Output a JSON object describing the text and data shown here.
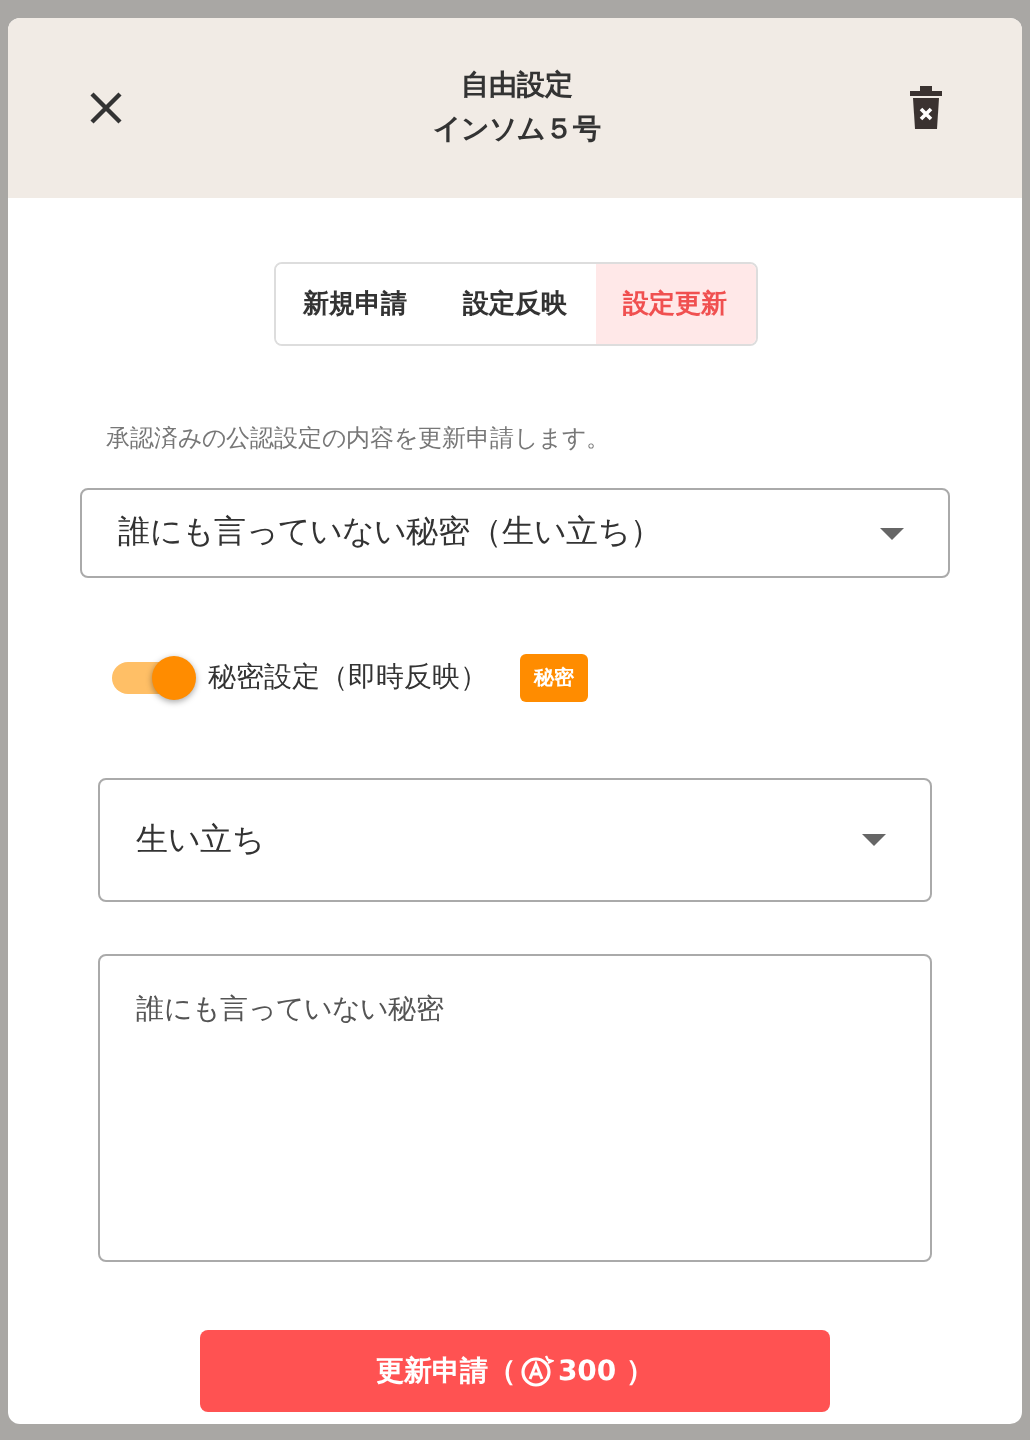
{
  "header": {
    "title": "自由設定",
    "subtitle": "インソム５号"
  },
  "tabs": [
    {
      "label": "新規申請",
      "selected": false
    },
    {
      "label": "設定反映",
      "selected": false
    },
    {
      "label": "設定更新",
      "selected": true
    }
  ],
  "description": "承認済みの公認設定の内容を更新申請します。",
  "setting_select": {
    "value": "誰にも言っていない秘密（生い立ち）"
  },
  "secret_toggle": {
    "label": "秘密設定（即時反映）",
    "on": true,
    "badge": "秘密"
  },
  "category_select": {
    "value": "生い立ち"
  },
  "content_field": {
    "value": "誰にも言っていない秘密"
  },
  "submit_button": {
    "label": "更新申請（",
    "cost": "300 ）"
  }
}
